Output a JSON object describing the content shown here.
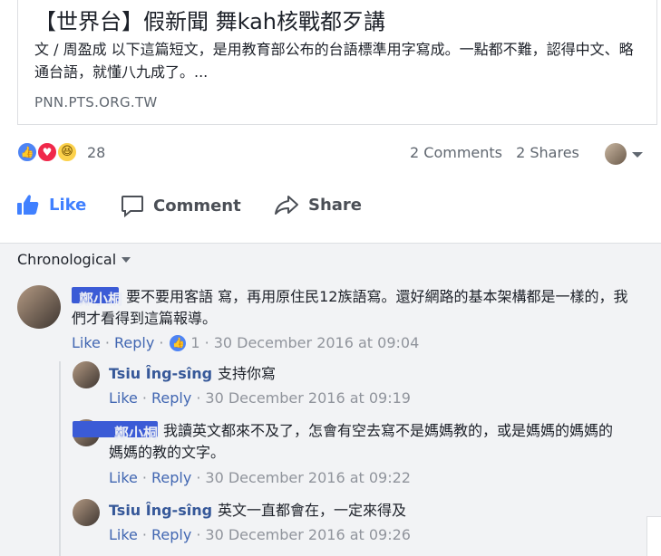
{
  "link": {
    "title": "【世界台】假新聞 舞kah核戰都歹講",
    "description": "文 / 周盈成 以下這篇短文，是用教育部公布的台語標準用字寫成。一點都不難，認得中文、略通台語，就懂八九成了。...",
    "domain": "PNN.PTS.ORG.TW"
  },
  "reactions": {
    "count": "28",
    "types": [
      "like",
      "love",
      "haha"
    ]
  },
  "stats": {
    "comments": "2 Comments",
    "shares": "2 Shares"
  },
  "actions": {
    "like": "Like",
    "comment": "Comment",
    "share": "Share"
  },
  "sort": {
    "label": "Chronological"
  },
  "comments": [
    {
      "name": "鄭小桐",
      "text": "要不要用客語 寫，再用原住民12族語寫。還好網路的基本架構都是一樣的，我們才看得到這篇報導。",
      "like": "Like",
      "reply": "Reply",
      "likes": "1",
      "time": "30 December 2016 at 09:04"
    },
    {
      "name": "Tsiu Îng-sîng",
      "text": "支持你寫",
      "like": "Like",
      "reply": "Reply",
      "time": "30 December 2016 at 09:19"
    },
    {
      "name": "鄭小桐",
      "text": "我讀英文都來不及了，怎會有空去寫不是媽媽教的，或是媽媽的媽媽的媽媽的教的文字。",
      "like": "Like",
      "reply": "Reply",
      "time": "30 December 2016 at 09:22"
    },
    {
      "name": "Tsiu Îng-sîng",
      "text": "英文一直都會在，一定來得及",
      "like": "Like",
      "reply": "Reply",
      "time": "30 December 2016 at 09:26"
    }
  ],
  "colors": {
    "accent": "#4267b2",
    "like_blue": "#4080ff",
    "love": "#f0284a",
    "haha": "#fcd14b",
    "bg_comments": "#f2f3f5"
  }
}
